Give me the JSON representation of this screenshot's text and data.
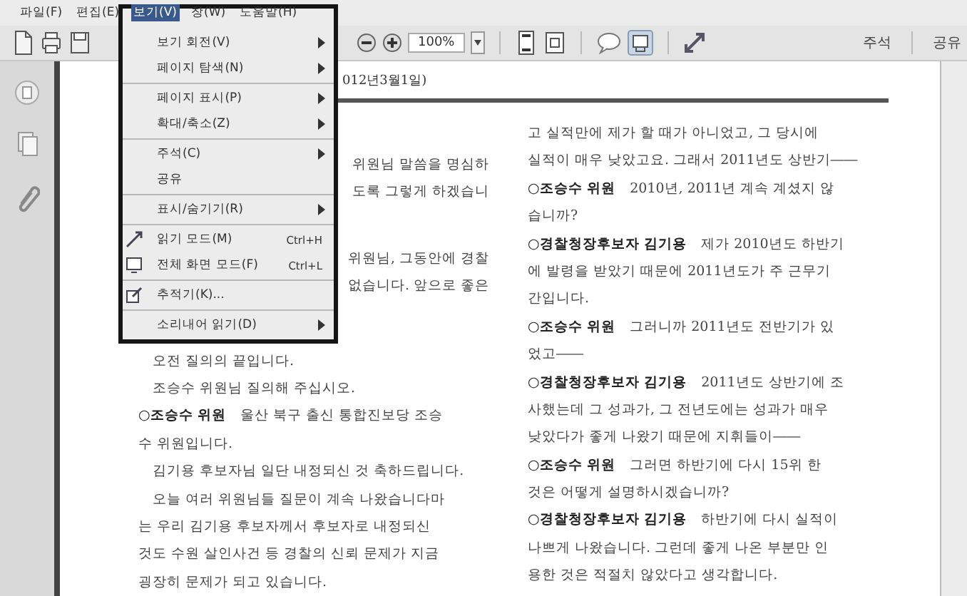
{
  "menu_bar": [
    {
      "label": "파일(F)",
      "selected": false
    },
    {
      "label": "편집(E)",
      "selected": false
    },
    {
      "label": "보기(V)",
      "selected": true
    },
    {
      "label": "창(W)",
      "selected": false
    },
    {
      "label": "도움말(H)",
      "selected": false
    }
  ],
  "toolbar": {
    "zoom": "100%",
    "right_buttons": [
      "주석",
      "공유"
    ]
  },
  "open_menu": {
    "groups": [
      [
        {
          "label": "보기 회전(V)",
          "submenu": true
        },
        {
          "label": "페이지 탐색(N)",
          "submenu": true
        }
      ],
      [
        {
          "label": "페이지 표시(P)",
          "submenu": true
        },
        {
          "label": "확대/축소(Z)",
          "submenu": true
        }
      ],
      [
        {
          "label": "주석(C)",
          "submenu": true
        },
        {
          "label": "공유",
          "submenu": false
        }
      ],
      [
        {
          "label": "표시/숨기기(R)",
          "submenu": true
        }
      ],
      [
        {
          "label": "읽기 모드(M)",
          "submenu": false,
          "kind": "icon",
          "shortcut": "Ctrl+H"
        },
        {
          "label": "전체 화면 모드(F)",
          "submenu": false,
          "kind": "icon",
          "shortcut": "Ctrl+L"
        }
      ],
      [
        {
          "label": "추적기(K)...",
          "submenu": false,
          "kind": "icon"
        }
      ],
      [
        {
          "label": "소리내어 읽기(D)",
          "submenu": true
        }
      ]
    ]
  },
  "document": {
    "header": "012년3월1일)",
    "left_column": [
      {
        "kind": "fragment",
        "lines": [
          "위원님 말씀을 명심하",
          "도록 그렇게 하겠습니"
        ]
      },
      {
        "kind": "fragment",
        "lines": [
          "위원님, 그동안에 경찰",
          "없습니다. 앞으로 좋은"
        ]
      },
      {
        "kind": "full",
        "lines": [
          "　오전 질의의 끝입니다.",
          "　조승수 위원님 질의해 주십시오.",
          "**○조승수 위원**　울산 북구 출신 통합진보당 조승",
          "수 위원입니다.",
          "　김기용 후보자님 일단 내정되신 것 축하드립니다.",
          "　오늘 여러 위원님들 질문이 계속 나왔습니다마",
          "는 우리 김기용 후보자께서 후보자로 내정되신",
          "것도 수원 살인사건 등 경찰의 신뢰 문제가 지금",
          "굉장히 문제가 되고 있습니다."
        ]
      }
    ],
    "right_column": [
      "고 실적만에 제가 할 때가 아니었고, 그 당시에",
      "실적이 매우 낮았고요. 그래서 2011년도 상반기――",
      "**○조승수 위원**　2010년, 2011년 계속 계셨지 않",
      "습니까?",
      "**○경찰청장후보자 김기용**　제가 2010년도 하반기",
      "에 발령을 받았기 때문에 2011년도가 주 근무기",
      "간입니다.",
      "**○조승수 위원**　그러니까 2011년도 전반기가 있",
      "었고――",
      "**○경찰청장후보자 김기용**　2011년도 상반기에 조",
      "사했는데 그 성과가, 그 전년도에는 성과가 매우",
      "낮았다가 좋게 나왔기 때문에 지휘들이――",
      "**○조승수 위원**　그러면 하반기에 다시 15위 한",
      "것은 어떻게 설명하시겠습니까?",
      "**○경찰청장후보자 김기용**　하반기에 다시 실적이",
      "나쁘게 나왔습니다. 그런데 좋게 나온 부분만 인",
      "용한 것은 적절치 않았다고 생각합니다."
    ]
  }
}
